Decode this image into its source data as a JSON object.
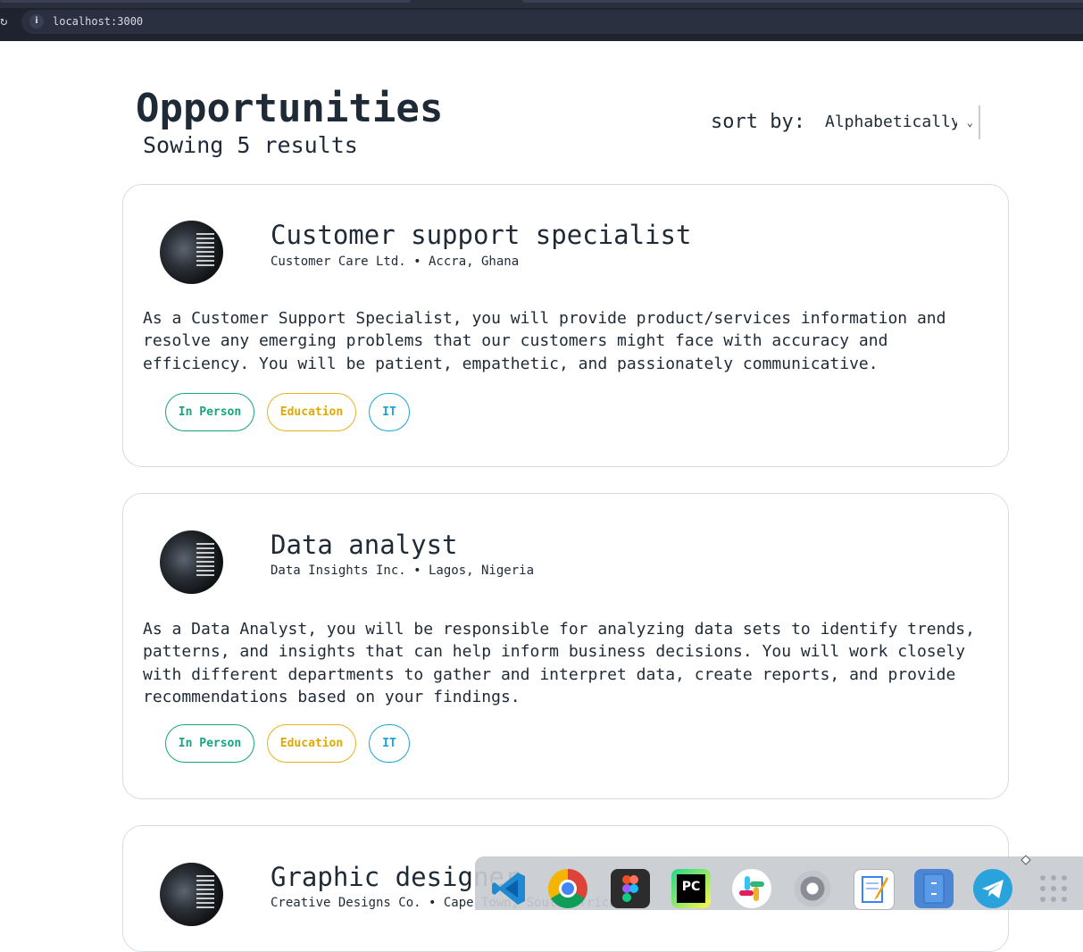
{
  "browser": {
    "url": "localhost:3000"
  },
  "page": {
    "title": "Opportunities",
    "results_text": "Sowing 5 results",
    "sort_label": "sort by:",
    "sort_value": "Alphabetically"
  },
  "jobs": [
    {
      "title": "Customer support specialist",
      "meta": "Customer Care Ltd. • Accra, Ghana",
      "description": "As a Customer Support Specialist, you will provide product/services information and resolve any emerging problems that our customers might face with accuracy and efficiency. You will be patient, empathetic, and passionately communicative.",
      "tags": [
        "In Person",
        "Education",
        "IT"
      ]
    },
    {
      "title": "Data analyst",
      "meta": "Data Insights Inc. • Lagos, Nigeria",
      "description": "As a Data Analyst, you will be responsible for analyzing data sets to identify trends, patterns, and insights that can help inform business decisions. You will work closely with different departments to gather and interpret data, create reports, and provide recommendations based on your findings.",
      "tags": [
        "In Person",
        "Education",
        "IT"
      ]
    },
    {
      "title": "Graphic designer",
      "meta": "Creative Designs Co. • Cape Town, South Africa"
    }
  ],
  "tag_colors": {
    "In Person": "#16a37f",
    "Education": "#e0a800",
    "IT": "#1ba6d8"
  },
  "dock": {
    "apps": [
      "vscode-icon",
      "chrome-icon",
      "figma-icon",
      "pycharm-icon",
      "slack-icon",
      "settings-icon",
      "text-editor-icon",
      "files-icon",
      "telegram-icon",
      "app-grid-icon"
    ],
    "pycharm_label": "PC"
  }
}
